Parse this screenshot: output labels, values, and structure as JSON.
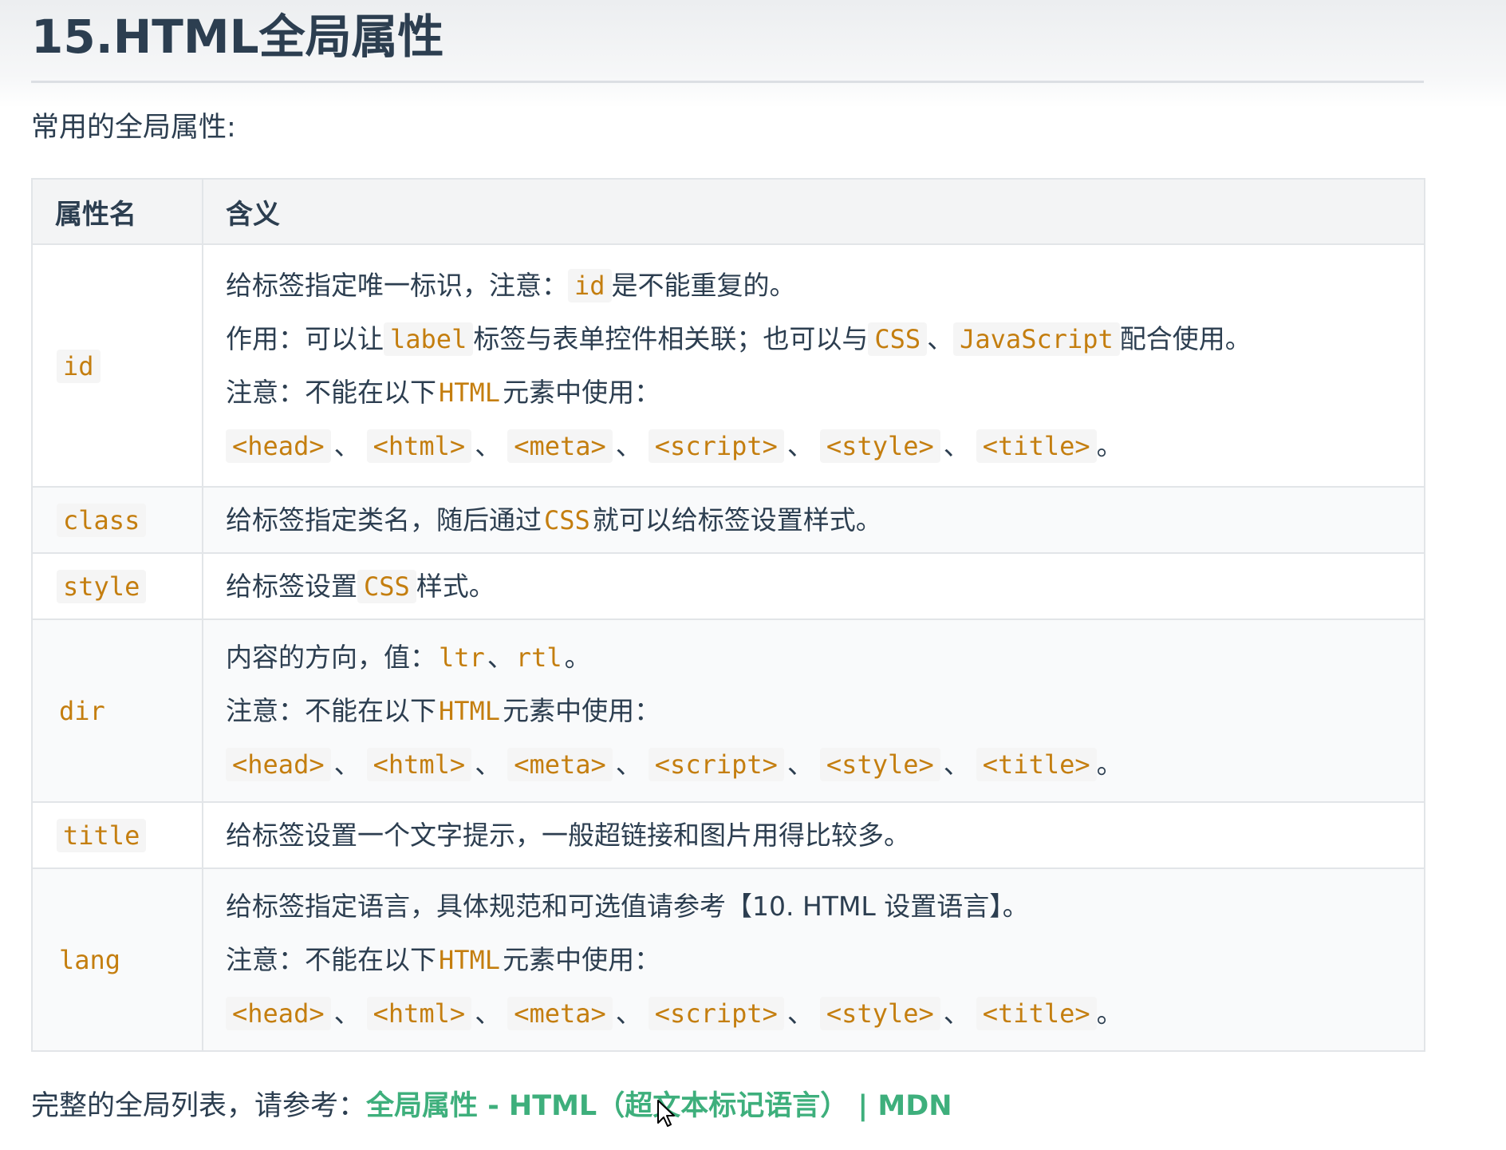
{
  "title": "15.HTML全局属性",
  "intro": "常用的全局属性:",
  "table": {
    "headers": [
      "属性名",
      "含义"
    ],
    "rows": {
      "id": {
        "name": "id",
        "line1": {
          "a": "给标签指定唯一标识，注意：",
          "code": "id",
          "b": "是不能重复的。"
        },
        "line2": {
          "a": "作用：可以让",
          "code1": "label",
          "b": "标签与表单控件相关联；也可以与",
          "code2": "CSS",
          "c": "、",
          "code3": "JavaScript",
          "d": "配合使用。"
        },
        "line3": {
          "a": "注意：不能在以下",
          "code": "HTML",
          "b": "元素中使用："
        },
        "elements": [
          "<head>",
          "<html>",
          "<meta>",
          "<script>",
          "<style>",
          "<title>"
        ]
      },
      "class": {
        "name": "class",
        "line1": {
          "a": "给标签指定类名，随后通过",
          "code": "CSS",
          "b": "就可以给标签设置样式。"
        }
      },
      "style": {
        "name": "style",
        "line1": {
          "a": "给标签设置",
          "code": "CSS",
          "b": "样式。"
        }
      },
      "dir": {
        "name": "dir",
        "line1": {
          "a": "内容的方向，值：",
          "code1": "ltr",
          "b": "、",
          "code2": "rtl",
          "c": "。"
        },
        "line2": {
          "a": "注意：不能在以下",
          "code": "HTML",
          "b": "元素中使用："
        },
        "elements": [
          "<head>",
          "<html>",
          "<meta>",
          "<script>",
          "<style>",
          "<title>"
        ]
      },
      "title": {
        "name": "title",
        "line1": {
          "a": "给标签设置一个文字提示，一般超链接和图片用得比较多。"
        }
      },
      "lang": {
        "name": "lang",
        "line1": {
          "a": "给标签指定语言，具体规范和可选值请参考【10. HTML 设置语言】。"
        },
        "line2": {
          "a": "注意：不能在以下",
          "code": "HTML",
          "b": "元素中使用："
        },
        "elements": [
          "<head>",
          "<html>",
          "<meta>",
          "<script>",
          "<style>",
          "<title>"
        ]
      }
    },
    "separator": "、",
    "end": "。"
  },
  "footer": {
    "prefix": "完整的全局列表，请参考：",
    "link_text": "全局属性 - HTML（超文本标记语言） | MDN"
  },
  "colors": {
    "text": "#2c3e50",
    "code": "#c47e0f",
    "link": "#3eaf7c",
    "header_bg": "#f3f4f5",
    "border": "#e2e5e8"
  },
  "icons": {
    "cursor": "mouse-pointer-icon"
  }
}
